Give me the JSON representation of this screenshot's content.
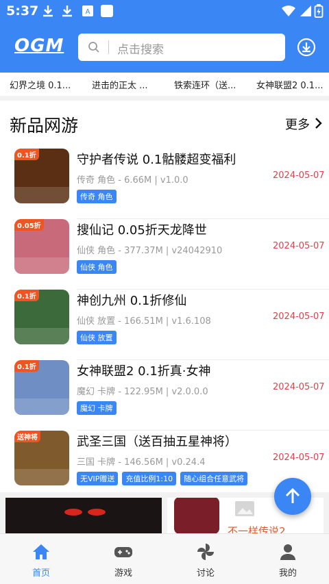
{
  "status_bar": {
    "time": "5:37"
  },
  "header": {
    "logo": "OGM",
    "search_placeholder": "点击搜索"
  },
  "tabs": [
    "幻界之境 0.1...",
    "进击的正太 ...",
    "铁索连环（送...",
    "女神联盟2 0.1..."
  ],
  "section": {
    "title": "新品网游",
    "more": "更多"
  },
  "games": [
    {
      "title": "守护者传说 0.1骷髅超变福利",
      "meta": "传奇 角色 - 6.66M | v1.0.0",
      "date": "2024-05-07",
      "tags": [
        "传奇 角色"
      ],
      "badge": "0.1折",
      "color": "#5a2f14"
    },
    {
      "title": "搜仙记 0.05折天龙降世",
      "meta": "仙侠 角色 - 377.37M | v24042910",
      "date": "2024-05-07",
      "tags": [
        "仙侠 角色"
      ],
      "badge": "0.05折",
      "color": "#c96a7a"
    },
    {
      "title": "神创九州 0.1折修仙",
      "meta": "仙侠 放置 - 166.51M | v1.6.108",
      "date": "2024-05-07",
      "tags": [
        "仙侠 放置"
      ],
      "badge": "0.1折",
      "color": "#3c6a3a"
    },
    {
      "title": "女神联盟2 0.1折真·女神",
      "meta": "魔幻 卡牌 - 122.95M | v2.0.0.0",
      "date": "2024-05-07",
      "tags": [
        "魔幻 卡牌"
      ],
      "badge": "0.1折",
      "color": "#6f8fc4"
    },
    {
      "title": "武圣三国（送百抽五星神将）",
      "meta": "三国 卡牌 - 146.56M | v0.24.4",
      "date": "2024-05-07",
      "tags": [
        "无VIP赠送",
        "充值比例1:10",
        "随心组合任意武将"
      ],
      "badge": "送神将",
      "color": "#7e5a2c"
    }
  ],
  "banner": {
    "right_text": "不一样传说2"
  },
  "bottom_nav": [
    {
      "label": "首页",
      "icon": "home-icon",
      "active": true
    },
    {
      "label": "游戏",
      "icon": "gamepad-icon",
      "active": false
    },
    {
      "label": "讨论",
      "icon": "pinwheel-icon",
      "active": false
    },
    {
      "label": "我的",
      "icon": "user-icon",
      "active": false
    }
  ],
  "colors": {
    "primary": "#3b86f5",
    "date": "#e0404a"
  }
}
